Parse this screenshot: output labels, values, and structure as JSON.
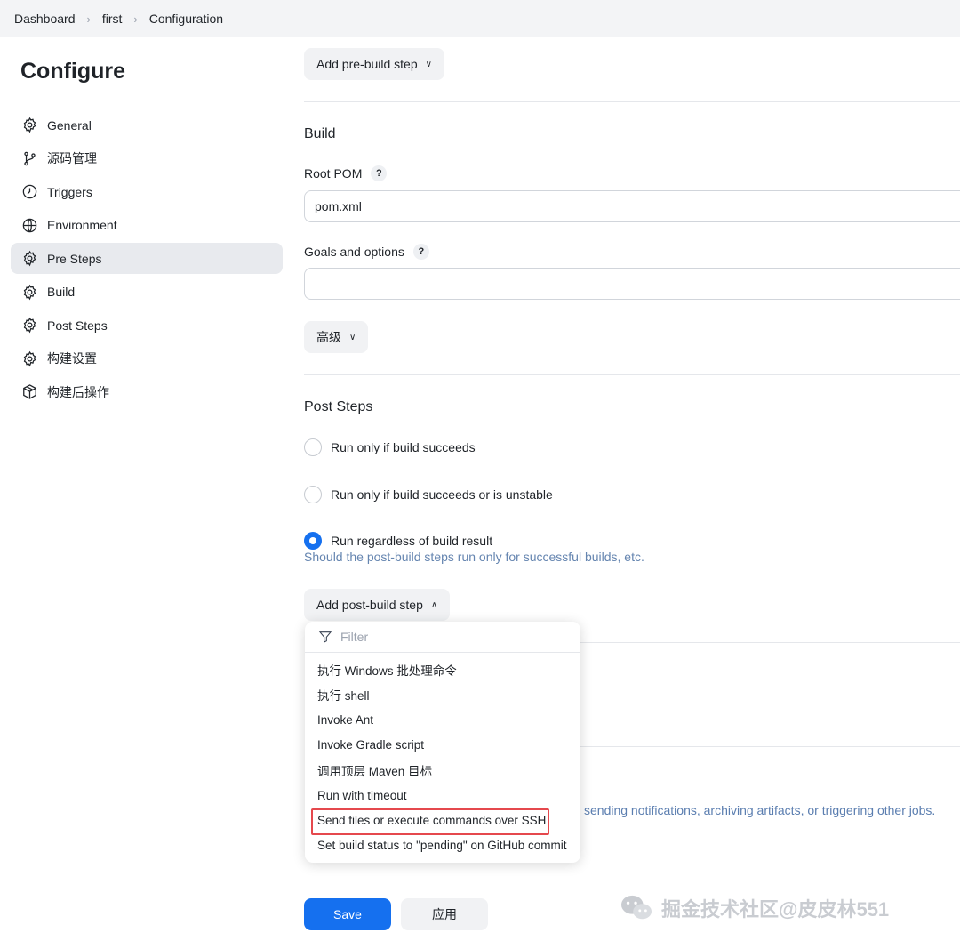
{
  "breadcrumb": {
    "items": [
      "Dashboard",
      "first",
      "Configuration"
    ],
    "separator": "›"
  },
  "sidebar": {
    "title": "Configure",
    "items": [
      {
        "label": "General",
        "icon": "gear-icon"
      },
      {
        "label": "源码管理",
        "icon": "branch-icon"
      },
      {
        "label": "Triggers",
        "icon": "clock-icon"
      },
      {
        "label": "Environment",
        "icon": "globe-icon"
      },
      {
        "label": "Pre Steps",
        "icon": "gear-icon",
        "active": true
      },
      {
        "label": "Build",
        "icon": "gear-icon"
      },
      {
        "label": "Post Steps",
        "icon": "gear-icon"
      },
      {
        "label": "构建设置",
        "icon": "gear-icon"
      },
      {
        "label": "构建后操作",
        "icon": "package-icon"
      }
    ]
  },
  "main": {
    "add_pre_build_label": "Add pre-build step",
    "build": {
      "title": "Build",
      "root_pom_label": "Root POM",
      "root_pom_value": "pom.xml",
      "goals_label": "Goals and options",
      "goals_value": "",
      "help_glyph": "?",
      "advanced_label": "高级"
    },
    "post_steps": {
      "title": "Post Steps",
      "options": [
        {
          "label": "Run only if build succeeds",
          "checked": false
        },
        {
          "label": "Run only if build succeeds or is unstable",
          "checked": false
        },
        {
          "label": "Run regardless of build result",
          "checked": true
        }
      ],
      "hint": "Should the post-build steps run only for successful builds, etc.",
      "add_post_build_label": "Add post-build step"
    },
    "background_hint": "sending notifications, archiving artifacts, or triggering other jobs."
  },
  "dropdown": {
    "filter_placeholder": "Filter",
    "items": [
      "执行 Windows 批处理命令",
      "执行 shell",
      "Invoke Ant",
      "Invoke Gradle script",
      "调用顶层 Maven 目标",
      "Run with timeout",
      "Send files or execute commands over SSH",
      "Set build status to \"pending\" on GitHub commit"
    ],
    "highlighted_index": 6
  },
  "footer": {
    "save_label": "Save",
    "apply_label": "应用"
  },
  "watermark": {
    "text": "掘金技术社区@皮皮林551"
  },
  "colors": {
    "primary": "#1570ef",
    "highlight_border": "#e5484d",
    "hint": "#6585b0"
  }
}
